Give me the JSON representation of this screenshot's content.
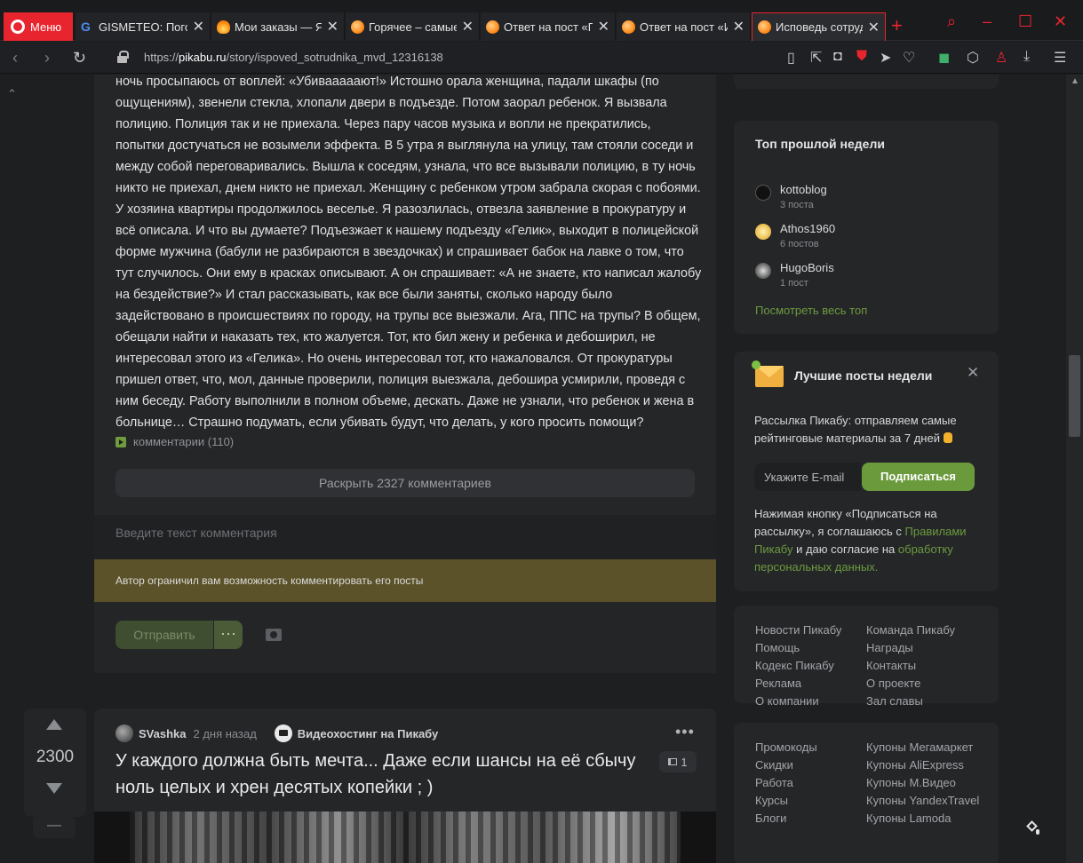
{
  "browser": {
    "menu_label": "Меню",
    "tabs": [
      {
        "title": "GISMETEO: Погода"
      },
      {
        "title": "Мои заказы — Ян"
      },
      {
        "title": "Горячее – самые"
      },
      {
        "title": "Ответ на пост «По"
      },
      {
        "title": "Ответ на пост «Ис"
      },
      {
        "title": "Исповедь сотрудн"
      }
    ],
    "url_prefix": "https://",
    "url_domain": "pikabu.ru",
    "url_path": "/story/ispoved_sotrudnika_mvd_12316138",
    "new_tab_symbol": "+"
  },
  "story": {
    "text": "ночь просыпаюсь от воплей: «Убивааааают!» Истошно орала женщина, падали шкафы (по ощущениям), звенели стекла, хлопали двери в подъезде. Потом заорал ребенок. Я вызвала полицию. Полиция так и не приехала. Через пару часов музыка и вопли не прекратились, попытки достучаться не возымели эффекта. В 5 утра я выглянула на улицу, там стояли соседи и между собой переговаривались. Вышла к соседям, узнала, что все вызывали полицию, в ту ночь никто не приехал, днем никто не приехал. Женщину с ребенком утром забрала скорая с побоями. У хозяина квартиры продолжилось веселье. Я разозлилась, отвезла заявление в прокуратуру и всё описала. И что вы думаете? Подъезжает к нашему подъезду «Гелик», выходит в полицейской форме мужчина (бабули не разбираются в звездочках) и спрашивает бабок на лавке о том, что тут случилось. Они ему в красках описывают. А он спрашивает: «А не знаете, кто написал жалобу на бездействие?» И стал рассказывать, как все были заняты, сколько народу было задействовано в происшествиях по городу, на трупы все выезжали. Ага, ППС на трупы? В общем, обещали найти и наказать тех, кто жалуется. Тот, кто бил жену и ребенка и дебоширил, не интересовал этого из «Гелика». Но очень интересовал тот, кто нажаловался. От прокуратуры пришел ответ, что, мол, данные проверили, полиция выезжала, дебошира усмирили, проведя с ним беседу. Работу выполнили в полном объеме, дескать. Даже не узнали, что ребенок и жена в больнице… Страшно подумать, если убивать будут, что делать, у кого просить помощи?",
    "comments_link": "комментарии (110)",
    "expand_button": "Раскрыть 2327 комментариев"
  },
  "comment_form": {
    "placeholder": "Введите текст комментария",
    "restriction_notice": "Автор ограничил вам возможность комментировать его посты",
    "send_button": "Отправить",
    "more_button": "···"
  },
  "next_post": {
    "rating": "2300",
    "author": "SVashka",
    "time": "2 дня назад",
    "community": "Видеохостинг на Пикабу",
    "title": "У каждого должна быть мечта... Даже если шансы на её сбычу ноль целых и хрен десятых копейки ; )",
    "repost_count": "1",
    "minus_symbol": "—"
  },
  "sidebar": {
    "top_week": {
      "title": "Топ прошлой недели",
      "users": [
        {
          "name": "kottoblog",
          "count": "3 поста"
        },
        {
          "name": "Athos1960",
          "count": "6 постов"
        },
        {
          "name": "HugoBoris",
          "count": "1 пост"
        }
      ],
      "see_all": "Посмотреть весь топ"
    },
    "best_posts": {
      "title": "Лучшие посты недели",
      "description": "Рассылка Пикабу: отправляем самые рейтинговые материалы за 7 дней",
      "email_placeholder": "Укажите E-mail",
      "subscribe_button": "Подписаться",
      "consent_part1": "Нажимая кнопку «Подписаться на рассылку», я соглашаюсь с ",
      "consent_link1": "Правилами Пикабу",
      "consent_part2": " и даю согласие на ",
      "consent_link2": "обработку персональных данных."
    },
    "footer_col1": [
      "Новости Пикабу",
      "Помощь",
      "Кодекс Пикабу",
      "Реклама",
      "О компании"
    ],
    "footer_col2": [
      "Команда Пикабу",
      "Награды",
      "Контакты",
      "О проекте",
      "Зал славы"
    ],
    "footer_col3": [
      "Промокоды",
      "Скидки",
      "Работа",
      "Курсы",
      "Блоги"
    ],
    "footer_col4": [
      "Купоны Мегамаркет",
      "Купоны AliExpress",
      "Купоны М.Видео",
      "Купоны YandexTravel",
      "Купоны Lamoda"
    ]
  }
}
